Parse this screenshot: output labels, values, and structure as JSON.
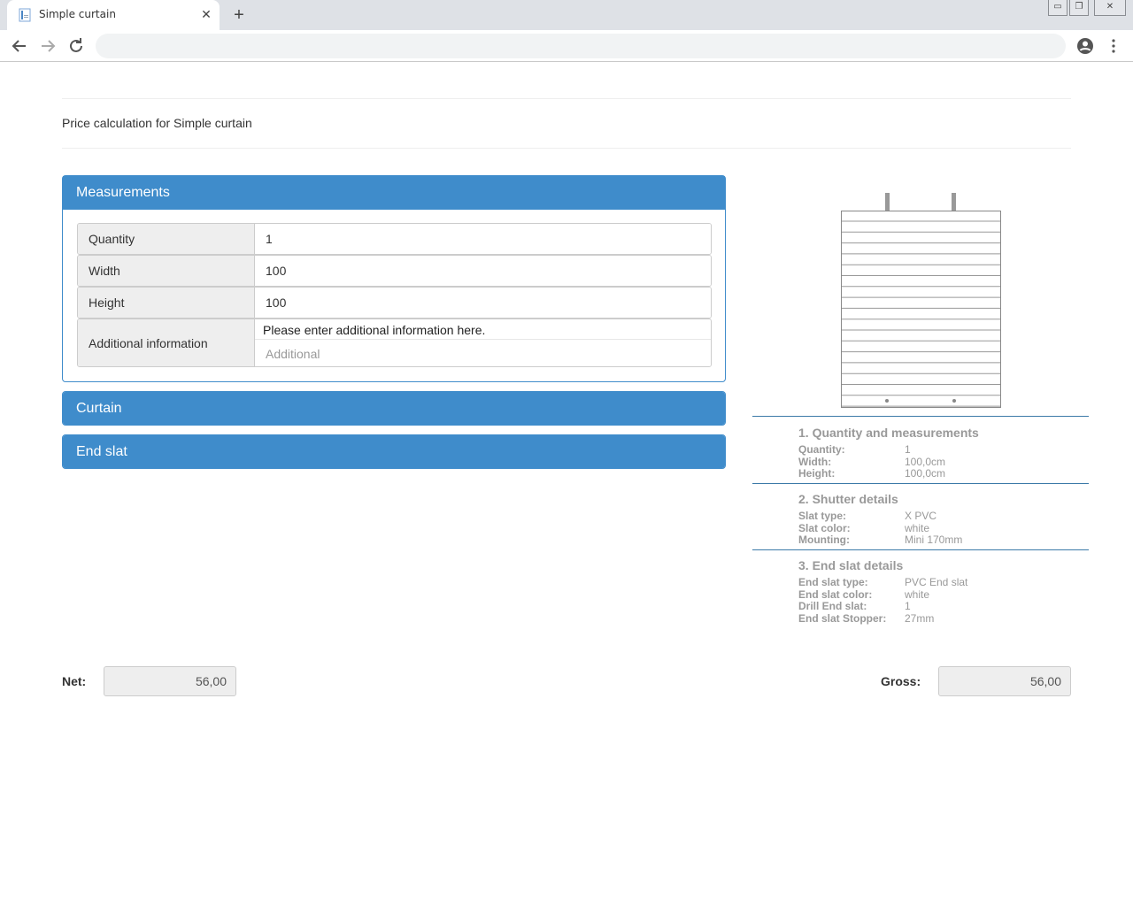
{
  "browser": {
    "tab_title": "Simple curtain",
    "tab_close": "✕",
    "new_tab": "+",
    "window_controls": {
      "minimize": "▭",
      "restore": "❐",
      "close": "✕"
    },
    "address_value": ""
  },
  "page": {
    "title": "Price calculation for Simple curtain"
  },
  "measurements": {
    "heading": "Measurements",
    "fields": [
      {
        "label": "Quantity",
        "value": "1"
      },
      {
        "label": "Width",
        "value": "100"
      },
      {
        "label": "Height",
        "value": "100"
      }
    ],
    "additional": {
      "label": "Additional information",
      "text": "Please enter additional information here.",
      "placeholder": "Additional"
    }
  },
  "panels": {
    "curtain": "Curtain",
    "end_slat": "End slat"
  },
  "summary": {
    "sections": [
      {
        "heading": "1. Quantity and measurements",
        "rows": [
          {
            "key": "Quantity:",
            "value": "1"
          },
          {
            "key": "Width:",
            "value": "100,0cm"
          },
          {
            "key": "Height:",
            "value": "100,0cm"
          }
        ]
      },
      {
        "heading": "2. Shutter details",
        "rows": [
          {
            "key": "Slat type:",
            "value": "X PVC"
          },
          {
            "key": "Slat color:",
            "value": "white"
          },
          {
            "key": "Mounting:",
            "value": "Mini 170mm"
          }
        ]
      },
      {
        "heading": "3. End slat details",
        "rows": [
          {
            "key": "End slat type:",
            "value": "PVC End slat"
          },
          {
            "key": "End slat color:",
            "value": "white"
          },
          {
            "key": "Drill End slat:",
            "value": "1"
          },
          {
            "key": "End slat Stopper:",
            "value": "27mm"
          }
        ]
      }
    ]
  },
  "totals": {
    "net_label": "Net:",
    "net_value": "56,00",
    "gross_label": "Gross:",
    "gross_value": "56,00"
  },
  "colors": {
    "accent": "#3f8ccb",
    "separator": "#3c7aa8"
  },
  "icons": [
    "document-icon",
    "back-arrow-icon",
    "forward-arrow-icon",
    "reload-icon",
    "account-icon",
    "menu-dots-icon"
  ]
}
